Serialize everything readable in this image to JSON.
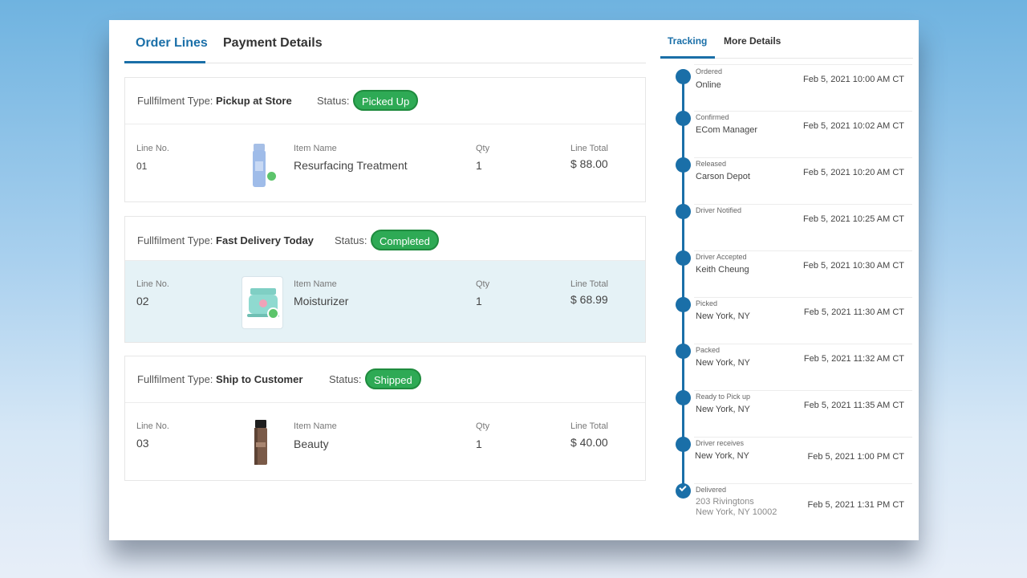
{
  "left_tabs": [
    "Order Lines",
    "Payment Details"
  ],
  "labels": {
    "fulfilment_type": "Fullfilment Type:",
    "status": "Status:",
    "line_no": "Line No.",
    "item_name": "Item Name",
    "qty": "Qty",
    "line_total": "Line Total"
  },
  "groups": [
    {
      "fulfilment_type": "Pickup at Store",
      "status": "Picked Up",
      "line_no": "01",
      "item_name": "Resurfacing Treatment",
      "qty": "1",
      "line_total": "$ 88.00",
      "product_icon": "serum-bottle-icon"
    },
    {
      "fulfilment_type": "Fast Delivery Today",
      "status": "Completed",
      "line_no": "02",
      "item_name": "Moisturizer",
      "qty": "1",
      "line_total": "$ 68.99",
      "product_icon": "cream-jar-icon"
    },
    {
      "fulfilment_type": "Ship to Customer",
      "status": "Shipped",
      "line_no": "03",
      "item_name": "Beauty",
      "qty": "1",
      "line_total": "$ 40.00",
      "product_icon": "foundation-bottle-icon"
    }
  ],
  "right_tabs": [
    "Tracking",
    "More Details"
  ],
  "tracking": [
    {
      "title": "Ordered",
      "sub": "Online",
      "time": "Feb 5, 2021  10:00 AM CT"
    },
    {
      "title": "Confirmed",
      "sub": "ECom Manager",
      "time": "Feb 5, 2021 10:02 AM CT"
    },
    {
      "title": "Released",
      "sub": "Carson Depot",
      "time": "Feb 5, 2021 10:20 AM CT"
    },
    {
      "title": "Driver Notified",
      "sub": "",
      "time": "Feb 5, 2021 10:25 AM CT"
    },
    {
      "title": "Driver Accepted",
      "sub": "Keith Cheung",
      "time": "Feb 5, 2021 10:30 AM CT"
    },
    {
      "title": "Picked",
      "sub": "New York, NY",
      "time": "Feb 5, 2021 11:30 AM CT"
    },
    {
      "title": "Packed",
      "sub": "New York, NY",
      "time": "Feb 5, 2021 11:32 AM CT"
    },
    {
      "title": "Ready to Pick up",
      "sub": "New York, NY",
      "time": "Feb 5, 2021 11:35 AM CT"
    },
    {
      "title": "Driver receives",
      "sub": "New York, NY",
      "time": "Feb 5, 2021 1:00 PM CT"
    },
    {
      "title": "Delivered",
      "sub": "203 Rivingtons",
      "sub2": "New York, NY 10002",
      "time": "Feb 5, 2021 1:31 PM CT"
    }
  ],
  "colors": {
    "accent": "#1a6fa8",
    "status_green": "#2eaa55",
    "highlight_row": "#e5f2f6"
  }
}
